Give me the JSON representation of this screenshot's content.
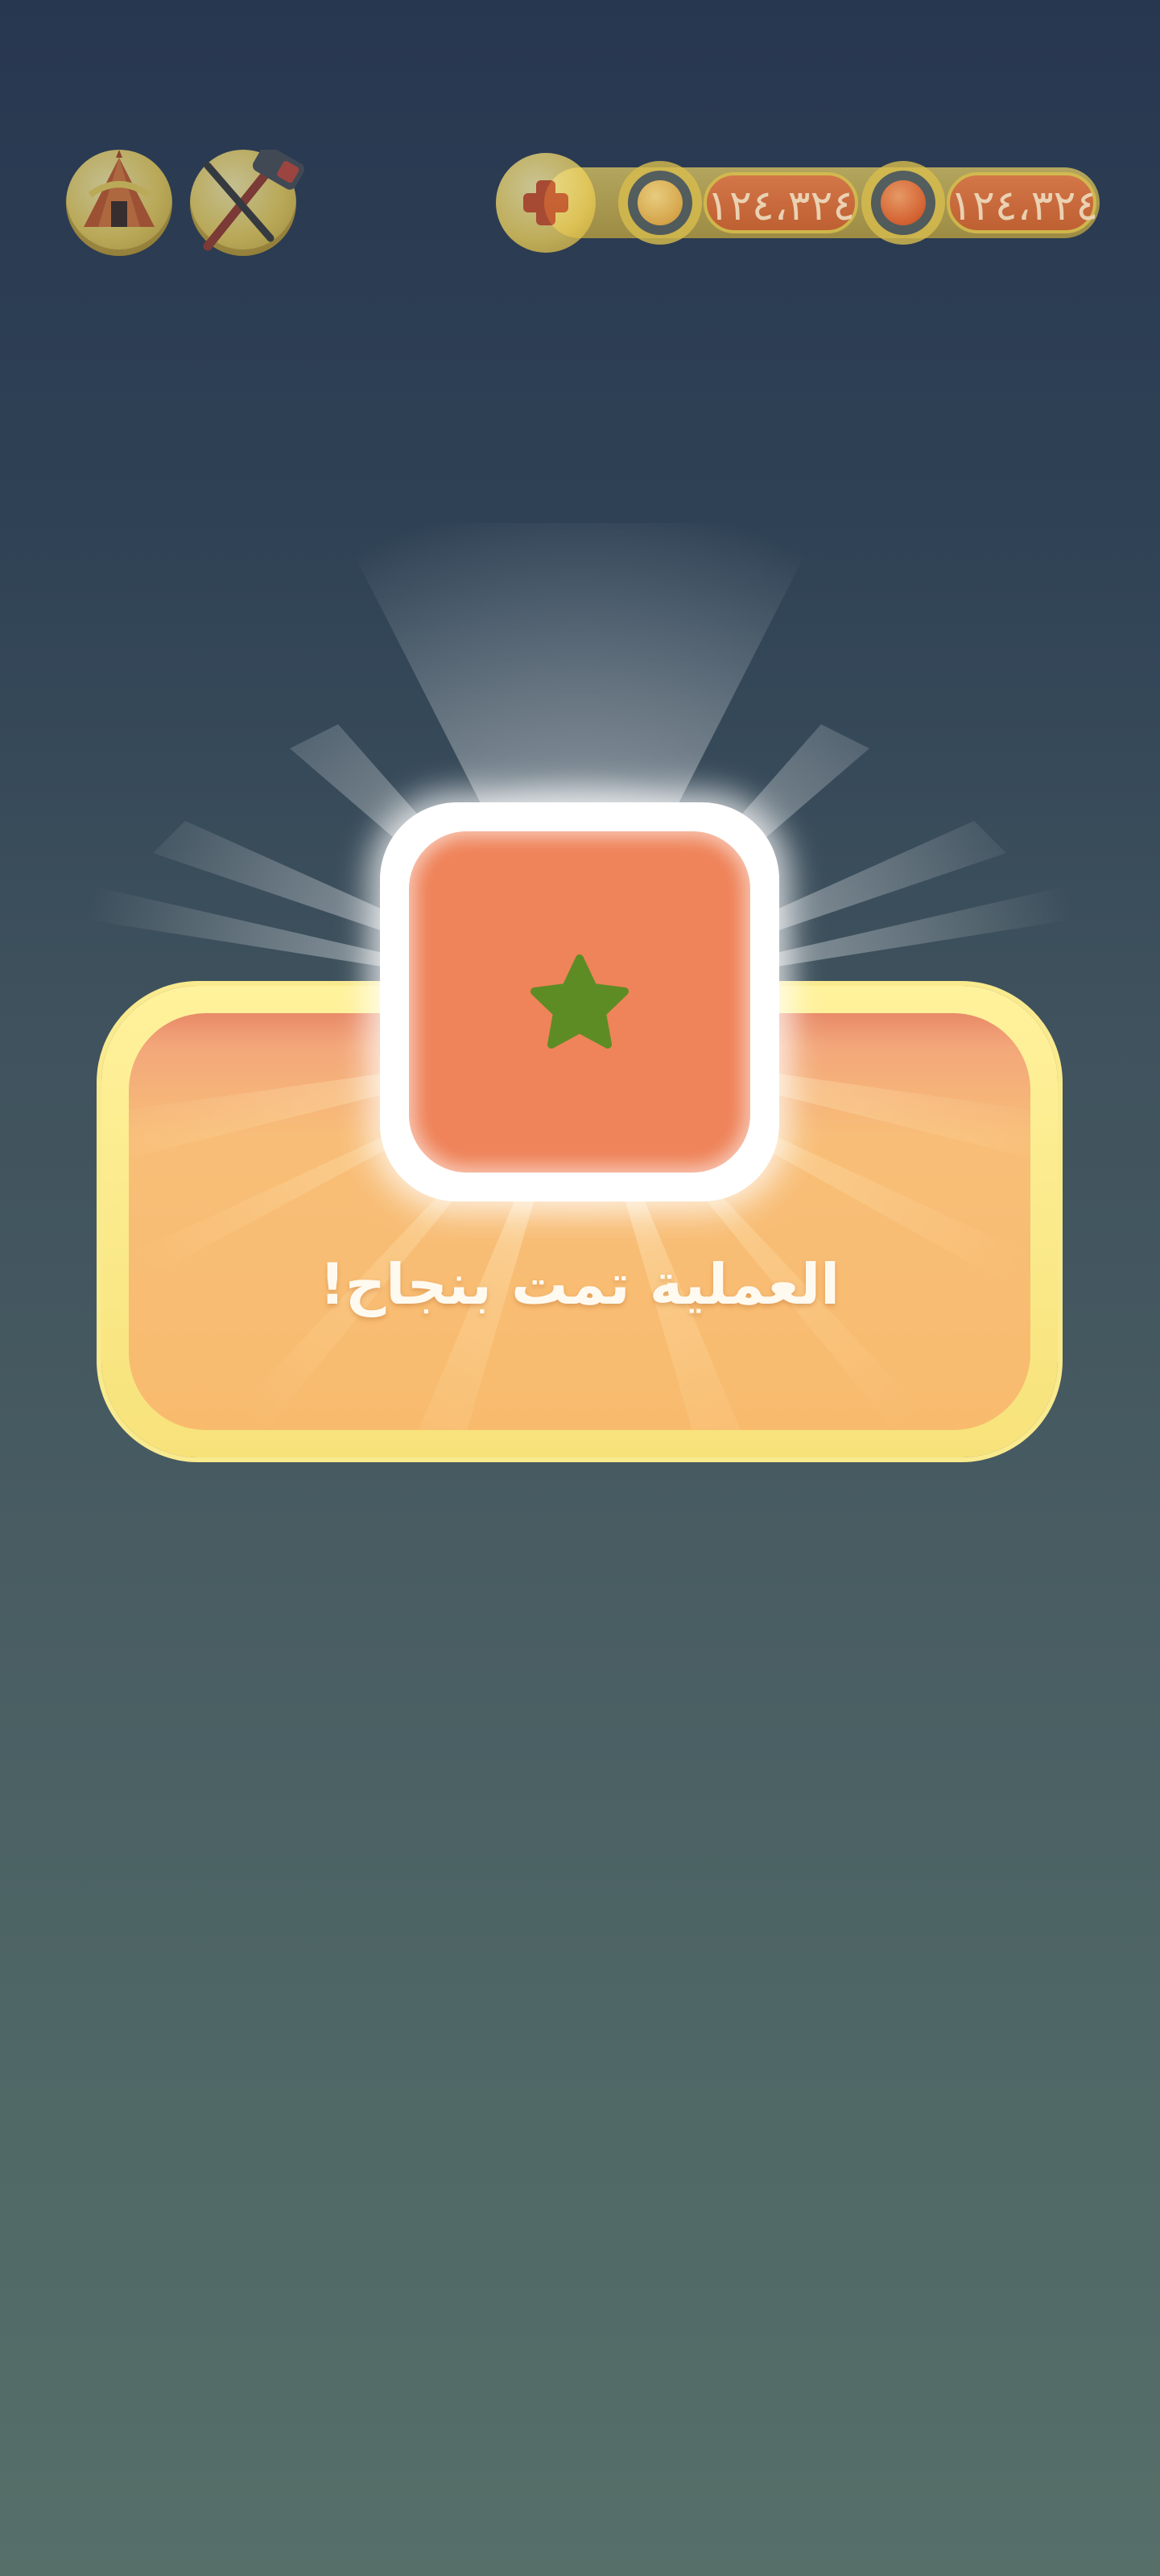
{
  "hud": {
    "tent_button": {
      "icon": "tent-icon"
    },
    "hammer_button": {
      "icon": "hammer-icon"
    },
    "currency": {
      "add_button": {
        "icon": "plus-icon"
      },
      "coins": {
        "icon": "coin-icon",
        "value": "١٢٤،٣٢٤"
      },
      "gems": {
        "icon": "orange-ball-icon",
        "value": "١٢٤،٣٢٤"
      }
    }
  },
  "reward": {
    "icon": "star-icon",
    "colors": {
      "card": "#ef8359",
      "star": "#5e8c24"
    }
  },
  "dialog": {
    "message": "العملية تمت بنجاح!",
    "colors": {
      "frame": "#f9ea8e",
      "panel": "#f8bb6e"
    }
  }
}
